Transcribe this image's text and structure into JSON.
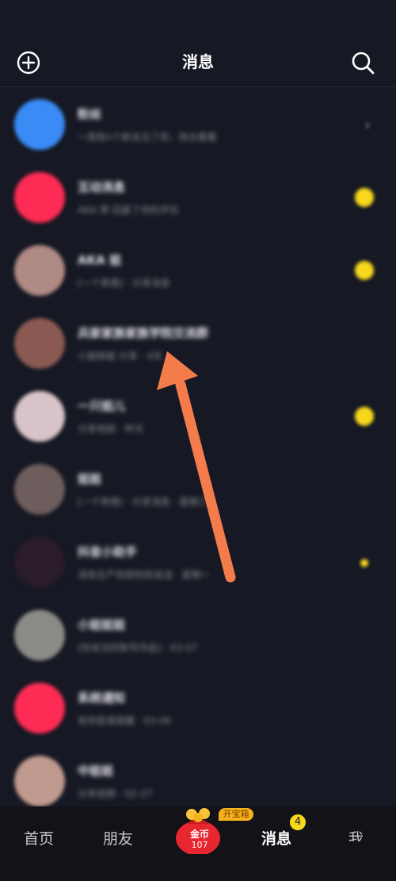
{
  "header": {
    "title": "消息"
  },
  "messages": [
    {
      "name": "粉丝",
      "preview": "一周有n个新关注了你，快去看看",
      "avatar_color": "#3a8bf6",
      "indicator": "chevron"
    },
    {
      "name": "互动消息",
      "preview": "AKA 赞 回复了你的评论",
      "avatar_color": "#fe2c55",
      "indicator": "dot"
    },
    {
      "name": "AKA 姐",
      "preview": "[一个表情]  ·  分享消息",
      "avatar_color": "#b08a84",
      "indicator": "dot"
    },
    {
      "name": "兵家家族家族学院交流群",
      "preview": "小姐妹姐 分享 · 4天",
      "avatar_color": "#8a5a52",
      "indicator": "none"
    },
    {
      "name": "一只姐儿",
      "preview": "分享视频  ·  昨天",
      "avatar_color": "#d8c4c8",
      "indicator": "dot"
    },
    {
      "name": "姐姐",
      "preview": "[一个表情]  ·  分享消息  ·  星期三",
      "avatar_color": "#6e5d5d",
      "indicator": "none"
    },
    {
      "name": "抖音小助手",
      "preview": "消息生产你把你别说话  ·  星期一",
      "avatar_color": "#2a1c28",
      "indicator": "small-dot"
    },
    {
      "name": "小姐姐姐",
      "preview": "[你关注的账号作品]  ·  03-07",
      "avatar_color": "#8c8a86",
      "indicator": "none"
    },
    {
      "name": "系统通知",
      "preview": "有你登录提醒  ·  03-06",
      "avatar_color": "#fe2c55",
      "indicator": "none"
    },
    {
      "name": "中姐姐",
      "preview": "分享视频  ·  02-27",
      "avatar_color": "#c09a8e",
      "indicator": "none"
    }
  ],
  "tabbar": {
    "home": "首页",
    "friends": "朋友",
    "coin_label": "金币",
    "coin_value": "107",
    "treasure_tag": "开宝箱",
    "messages": "消息",
    "messages_badge": "4",
    "me": "我"
  },
  "colors": {
    "background": "#161823",
    "accent_yellow": "#f8d81c",
    "arrow": "#f47c4b"
  },
  "icons": [
    "add-circle-icon",
    "search-icon",
    "chevron-right-icon",
    "coin-bag-icon"
  ]
}
